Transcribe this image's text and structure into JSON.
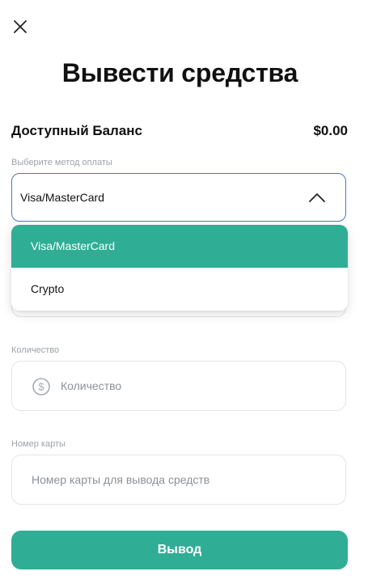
{
  "header": {
    "close_icon": "close-icon",
    "title": "Вывести средства"
  },
  "balance": {
    "label": "Доступный Баланс",
    "value": "$0.00"
  },
  "payment_method": {
    "label": "Выберите метод оплаты",
    "selected": "Visa/MasterCard",
    "options": [
      "Visa/MasterCard",
      "Crypto"
    ],
    "chevron_icon": "chevron-up-icon"
  },
  "amount": {
    "label": "Количество",
    "placeholder": "Количество",
    "value": "",
    "icon": "dollar-circle-icon"
  },
  "card_number": {
    "label": "Номер карты",
    "placeholder": "Номер карты для вывода средств",
    "value": ""
  },
  "submit": {
    "label": "Вывод"
  },
  "colors": {
    "accent": "#2fae95",
    "select_border": "#4a78c2",
    "muted_label": "#9ea3a8",
    "input_border": "#e3e5e8"
  }
}
